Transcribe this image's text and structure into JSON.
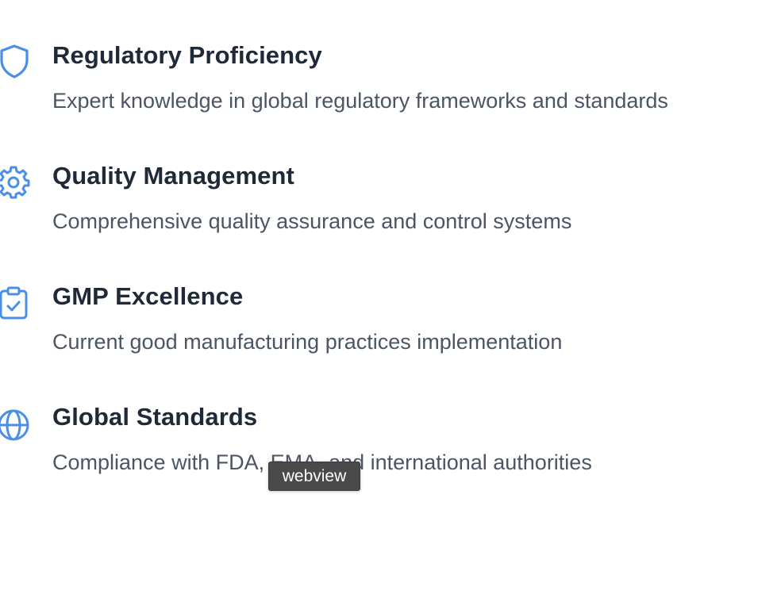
{
  "features": [
    {
      "icon": "shield-icon",
      "title": "Regulatory Proficiency",
      "description": "Expert knowledge in global regulatory frameworks and standards"
    },
    {
      "icon": "gear-icon",
      "title": "Quality Management",
      "description": "Comprehensive quality assurance and control systems"
    },
    {
      "icon": "clipboard-check-icon",
      "title": "GMP Excellence",
      "description": "Current good manufacturing practices implementation"
    },
    {
      "icon": "globe-icon",
      "title": "Global Standards",
      "description": "Compliance with FDA, EMA, and international authorities"
    }
  ],
  "tooltip": {
    "text": "webview"
  },
  "colors": {
    "icon_accent": "#4a8fe7",
    "title": "#1f2937",
    "description": "#4b5563",
    "tooltip_bg": "#4a4a4a"
  }
}
